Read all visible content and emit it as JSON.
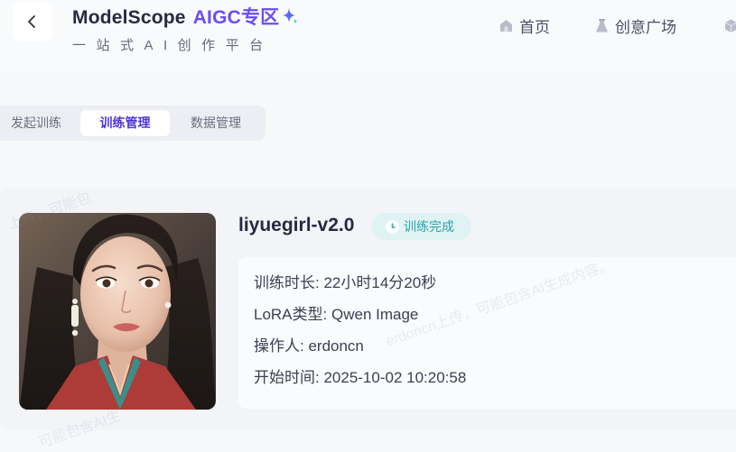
{
  "header": {
    "brand_name": "ModelScope",
    "brand_section": "AIGC专区",
    "subtitle": "一站式AI创作平台",
    "nav": [
      {
        "label": "首页",
        "icon": "home-icon"
      },
      {
        "label": "创意广场",
        "icon": "flask-icon"
      },
      {
        "label": "",
        "icon": "cube-icon"
      }
    ]
  },
  "tabs": [
    {
      "label": "发起训练",
      "active": false
    },
    {
      "label": "训练管理",
      "active": true
    },
    {
      "label": "数据管理",
      "active": false
    }
  ],
  "model": {
    "name": "liyuegirl-v2.0",
    "status": "训练完成",
    "info": [
      {
        "label": "训练时长",
        "value": "22小时14分20秒"
      },
      {
        "label": "LoRA类型",
        "value": "Qwen Image"
      },
      {
        "label": "操作人",
        "value": "erdoncn"
      },
      {
        "label": "开始时间",
        "value": "2025-10-02 10:20:58"
      }
    ]
  },
  "watermark": {
    "text_1": "上传，可能包",
    "text_2": "erdoncn上传，可能包含AI生成内容。",
    "text_3": "可能包含AI生"
  },
  "colors": {
    "accent": "#6a4df2",
    "status_text": "#2ca3a8",
    "status_bg": "#dff3f4"
  }
}
